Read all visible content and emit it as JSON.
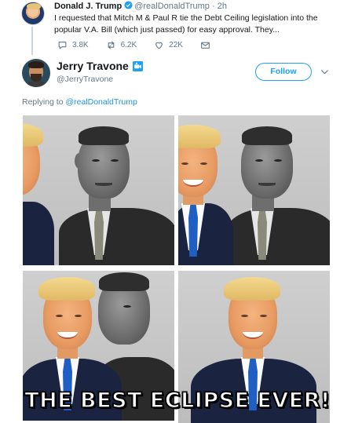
{
  "parent_tweet": {
    "name": "Donald J. Trump",
    "handle": "@realDonaldTrump",
    "separator": "·",
    "time": "2h",
    "text": "I requested that Mitch M & Paul R tie the Debt Ceiling legislation into the popular V.A. Bill (which just passed) for easy approval. They...",
    "replies": "3.8K",
    "retweets": "6.2K",
    "likes": "22K",
    "icons": [
      "reply-icon",
      "retweet-icon",
      "like-icon",
      "message-icon"
    ]
  },
  "tweet": {
    "name": "Jerry Travone",
    "handle": "@JerryTravone",
    "follow_label": "Follow",
    "replying_prefix": "Replying to",
    "replying_to": "@realDonaldTrump",
    "image_caption": "THE BEST ECLIPSE EVER!"
  },
  "colors": {
    "accent": "#1da1f2",
    "muted_text": "#657786",
    "verified": "#1da1f2"
  }
}
